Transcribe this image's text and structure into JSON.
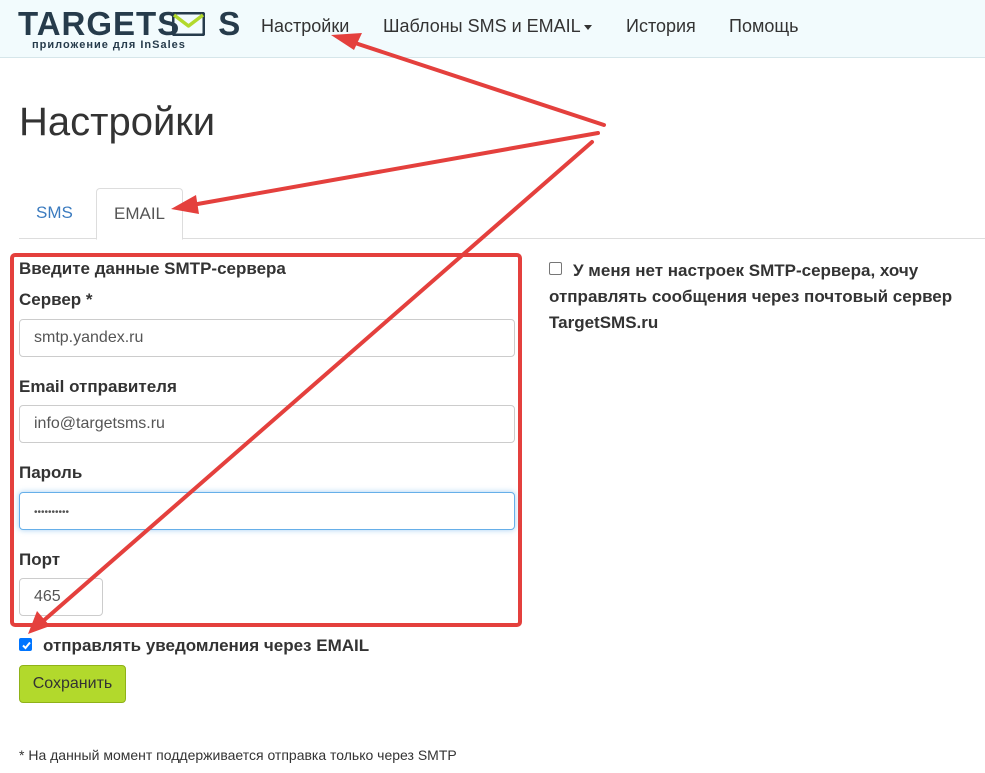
{
  "logo": {
    "main_pre": "TARGETS",
    "main_post": "S",
    "tagline": "приложение для InSales"
  },
  "nav": {
    "items": [
      {
        "label": "Настройки"
      },
      {
        "label": "Шаблоны SMS и EMAIL"
      },
      {
        "label": "История"
      },
      {
        "label": "Помощь"
      }
    ]
  },
  "page": {
    "title": "Настройки"
  },
  "tabs": [
    {
      "label": "SMS",
      "active": false
    },
    {
      "label": "EMAIL",
      "active": true
    }
  ],
  "smtp": {
    "section_title": "Введите данные SMTP-сервера",
    "server_label": "Сервер *",
    "server_value": "smtp.yandex.ru",
    "email_label": "Email отправителя",
    "email_value": "info@targetsms.ru",
    "password_label": "Пароль",
    "password_value": "••••••••••",
    "port_label": "Порт",
    "port_value": "465"
  },
  "no_smtp_option": {
    "label": "У меня нет настроек SMTP-сервера, хочу отправлять сообщения через почтовый сервер TargetSMS.ru",
    "checked": false
  },
  "notify_option": {
    "label": "отправлять уведомления через EMAIL",
    "checked": true
  },
  "save_button": {
    "label": "Сохранить"
  },
  "footnote": "* На данный момент поддерживается отправка только через SMTP",
  "colors": {
    "annotation_red": "#e4403d",
    "save_green": "#b2d92c",
    "link_blue": "#3b7bbf",
    "checkbox_blue": "#0075ff",
    "navbar_bg": "#f2fbfd"
  }
}
